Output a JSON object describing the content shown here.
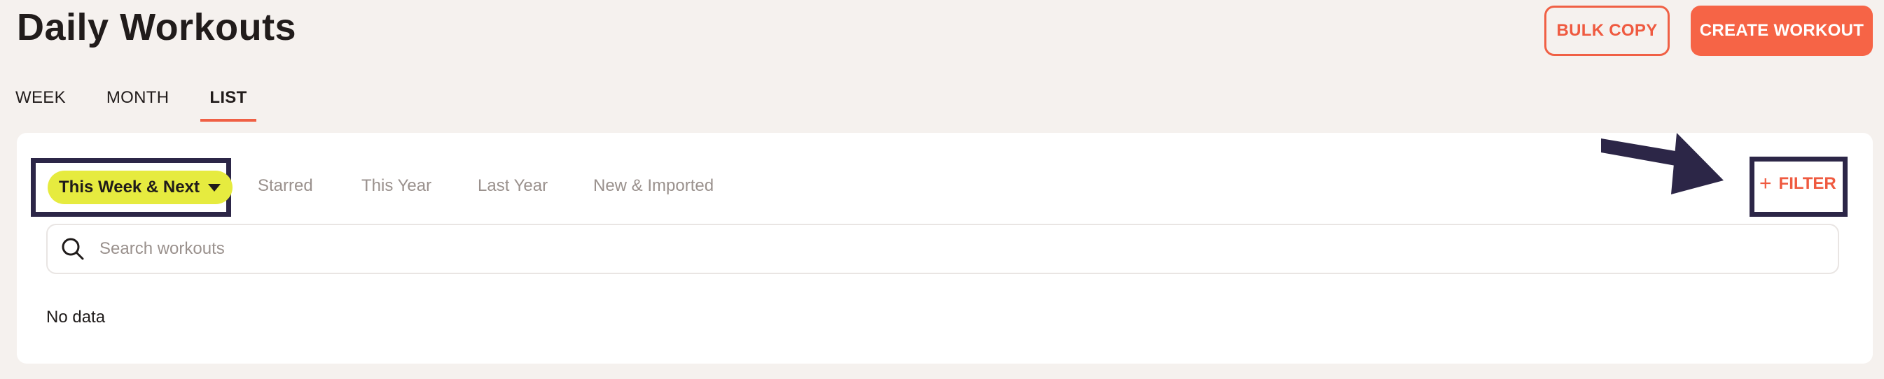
{
  "header": {
    "title": "Daily Workouts",
    "bulk_copy_label": "BULK COPY",
    "create_workout_label": "CREATE WORKOUT"
  },
  "view_tabs": {
    "week": "WEEK",
    "month": "MONTH",
    "list": "LIST",
    "active": "LIST"
  },
  "filters": {
    "preset_selected": "This Week & Next",
    "quick_filters": [
      "Starred",
      "This Year",
      "Last Year",
      "New & Imported"
    ],
    "filter_button_label": "FILTER"
  },
  "search": {
    "placeholder": "Search workouts",
    "value": ""
  },
  "results": {
    "empty_message": "No data"
  },
  "colors": {
    "accent": "#f06045",
    "preset_pill": "#e6eb3f",
    "annotation": "#2c2647",
    "background": "#f5f1ee"
  }
}
